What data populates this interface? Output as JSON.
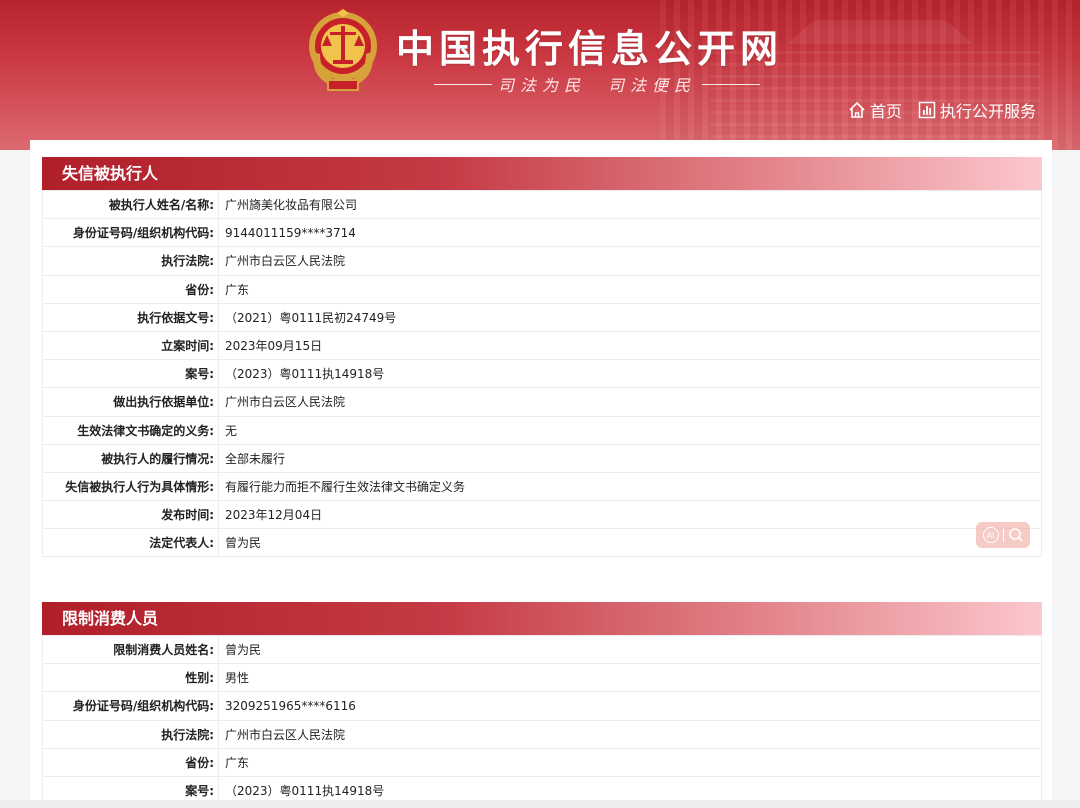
{
  "header": {
    "site_title": "中国执行信息公开网",
    "slogan": "司法为民　司法便民",
    "nav": [
      {
        "label": "首页",
        "icon": "home-icon"
      },
      {
        "label": "执行公开服务",
        "icon": "chart-icon"
      }
    ]
  },
  "section1": {
    "title": "失信被执行人",
    "rows": [
      {
        "label": "被执行人姓名/名称:",
        "value": "广州旖美化妆品有限公司"
      },
      {
        "label": "身份证号码/组织机构代码:",
        "value": "9144011159****3714"
      },
      {
        "label": "执行法院:",
        "value": "广州市白云区人民法院"
      },
      {
        "label": "省份:",
        "value": "广东"
      },
      {
        "label": "执行依据文号:",
        "value": "（2021）粤0111民初24749号"
      },
      {
        "label": "立案时间:",
        "value": "2023年09月15日"
      },
      {
        "label": "案号:",
        "value": "（2023）粤0111执14918号"
      },
      {
        "label": "做出执行依据单位:",
        "value": "广州市白云区人民法院"
      },
      {
        "label": "生效法律文书确定的义务:",
        "value": "无"
      },
      {
        "label": "被执行人的履行情况:",
        "value": "全部未履行"
      },
      {
        "label": "失信被执行人行为具体情形:",
        "value": "有履行能力而拒不履行生效法律文书确定义务"
      },
      {
        "label": "发布时间:",
        "value": "2023年12月04日"
      },
      {
        "label": "法定代表人:",
        "value": "曾为民"
      }
    ]
  },
  "section2": {
    "title": "限制消费人员",
    "rows": [
      {
        "label": "限制消费人员姓名:",
        "value": "曾为民"
      },
      {
        "label": "性别:",
        "value": "男性"
      },
      {
        "label": "身份证号码/组织机构代码:",
        "value": "3209251965****6116"
      },
      {
        "label": "执行法院:",
        "value": "广州市白云区人民法院"
      },
      {
        "label": "省份:",
        "value": "广东"
      },
      {
        "label": "案号:",
        "value": "（2023）粤0111执14918号"
      }
    ]
  },
  "badge": {
    "ai_label": "AI",
    "icons": [
      "ai-icon",
      "search-icon"
    ]
  },
  "colors": {
    "header_red": "#c93640",
    "section_red": "#b01f2a",
    "badge": "#efa096"
  }
}
